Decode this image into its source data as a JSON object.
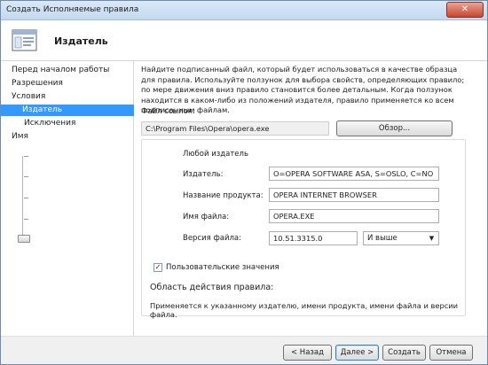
{
  "window": {
    "title": "Создать Исполняемые правила",
    "close_glyph": "✕"
  },
  "header": {
    "title": "Издатель",
    "icon": "wizard-window-icon"
  },
  "nav": {
    "items": [
      {
        "label": "Перед началом работы"
      },
      {
        "label": "Разрешения"
      },
      {
        "label": "Условия"
      },
      {
        "label": "Издатель",
        "selected": true
      },
      {
        "label": "Исключения"
      },
      {
        "label": "Имя"
      }
    ]
  },
  "main": {
    "description": "Найдите подписанный файл, который будет использоваться в качестве образца для правила. Используйте ползунок для выбора свойств, определяющих правило; по мере движения вниз правило становится более детальным. Когда ползунок находится в каком-либо из положений издателя, правило применяется ко всем подписанным файлам.",
    "reference_label": "Файл ссылок:",
    "reference_value": "C:\\Program Files\\Opera\\opera.exe",
    "browse_label": "Обзор...",
    "any_publisher_label": "Любой издатель",
    "publisher_label": "Издатель:",
    "publisher_value": "O=OPERA SOFTWARE ASA, S=OSLO, C=NO",
    "product_label": "Название продукта:",
    "product_value": "OPERA INTERNET BROWSER",
    "filename_label": "Имя файла:",
    "filename_value": "OPERA.EXE",
    "version_label": "Версия файла:",
    "version_value": "10.51.3315.0",
    "version_op": "И выше",
    "custom_values_label": "Пользовательские значения",
    "custom_values_checked": true,
    "scope_title": "Область действия правила:",
    "scope_text": "Применяется к указанному издателю, имени продукта, имени файла и версии файла."
  },
  "footer": {
    "back_label": "< Назад",
    "next_label": "Далее >",
    "create_label": "Создать",
    "cancel_label": "Отмена"
  },
  "colors": {
    "selection": "#3399ff",
    "title_bar": "#c3d8ef",
    "close_button": "#c7462d"
  }
}
